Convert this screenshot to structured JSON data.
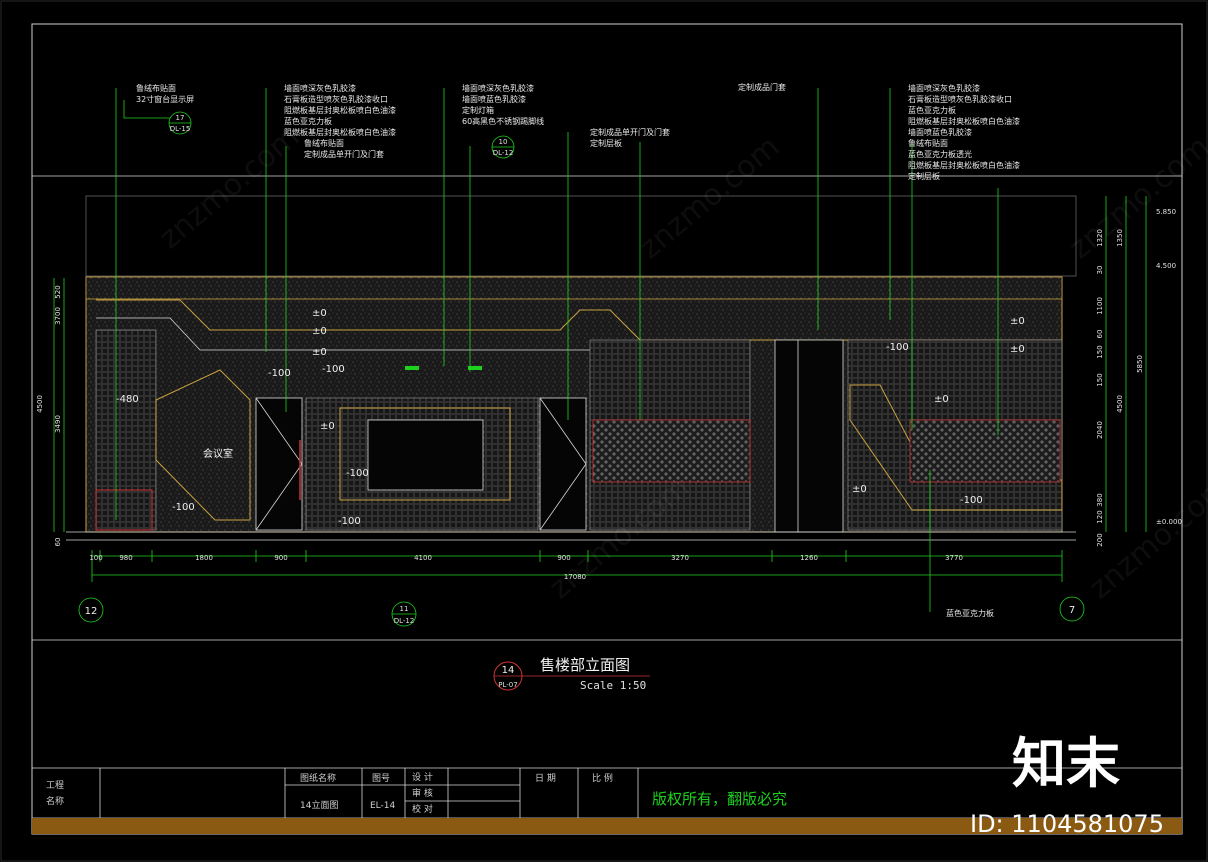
{
  "title": {
    "tag_number": "14",
    "tag_sheet": "PL-07",
    "name": "售楼部立面图",
    "scale": "Scale 1:50"
  },
  "callouts_left": [
    "鲁绒布贴面",
    "32寸窗台显示屏"
  ],
  "callout_17": {
    "num": "17",
    "sheet": "DL-15"
  },
  "callouts_mid1": [
    "墙面喷深灰色乳胶漆",
    "石膏板造型喷灰色乳胶漆收口",
    "阻燃板基层封奥松板喷白色油漆",
    "蓝色亚克力板",
    "阻燃板基层封奥松板喷白色油漆"
  ],
  "callouts_mid1b": [
    "鲁绒布贴面",
    "定制成品单开门及门套"
  ],
  "callouts_mid2": [
    "墙面喷深灰色乳胶漆",
    "墙面喷蓝色乳胶漆",
    "定制灯箱",
    "60高黑色不锈钢踢脚线"
  ],
  "callout_10": {
    "num": "10",
    "sheet": "DL-12"
  },
  "callouts_mid3": [
    "定制成品单开门及门套",
    "定制层板"
  ],
  "callout_door": "定制成品门套",
  "callouts_right": [
    "墙面喷深灰色乳胶漆",
    "石膏板造型喷灰色乳胶漆收口",
    "蓝色亚克力板",
    "阻燃板基层封奥松板喷白色油漆",
    "墙面喷蓝色乳胶漆",
    "鲁绒布贴面",
    "蓝色亚克力板透光",
    "阻燃板基层封奥松板喷白色油漆",
    "定制层板"
  ],
  "callout_bottom": "蓝色亚克力板",
  "room_label": "会议室",
  "levels": [
    "±0",
    "±0",
    "±0",
    "-100",
    "-480",
    "-100",
    "±0",
    "-100",
    "-100",
    "-100",
    "±0",
    "±0",
    "±0",
    "-100",
    "±0",
    "-100"
  ],
  "bottom_dims": [
    "100",
    "980",
    "1800",
    "900",
    "4100",
    "900",
    "3270",
    "1260",
    "3770"
  ],
  "total_dim": "17080",
  "left_dims": [
    "520",
    "3700",
    "4500",
    "3490",
    "60"
  ],
  "right_dims_a": [
    "1320",
    "30",
    "1100",
    "60",
    "150",
    "150",
    "2040",
    "380",
    "120",
    "200"
  ],
  "right_dims_b": [
    "1350",
    "4500",
    "5850"
  ],
  "right_elevations": [
    "5.850",
    "4.500",
    "±0.000"
  ],
  "axis_tags": [
    "12",
    "7"
  ],
  "axis_tag_11": {
    "num": "11",
    "sheet": "DL-12"
  },
  "title_block": {
    "project_label": "工程名称",
    "drawing_name_label": "图纸名称",
    "drawing_no_label": "图号",
    "design": "设 计",
    "review": "审 核",
    "check": "校 对",
    "date": "日 期",
    "scale": "比 例",
    "drawing_name": "14立面图",
    "drawing_no": "EL-14",
    "copyright": "版权所有，翻版必究"
  },
  "brand": {
    "logo": "知末",
    "id": "ID: 1104581075",
    "watermark": "znzmo.com"
  }
}
